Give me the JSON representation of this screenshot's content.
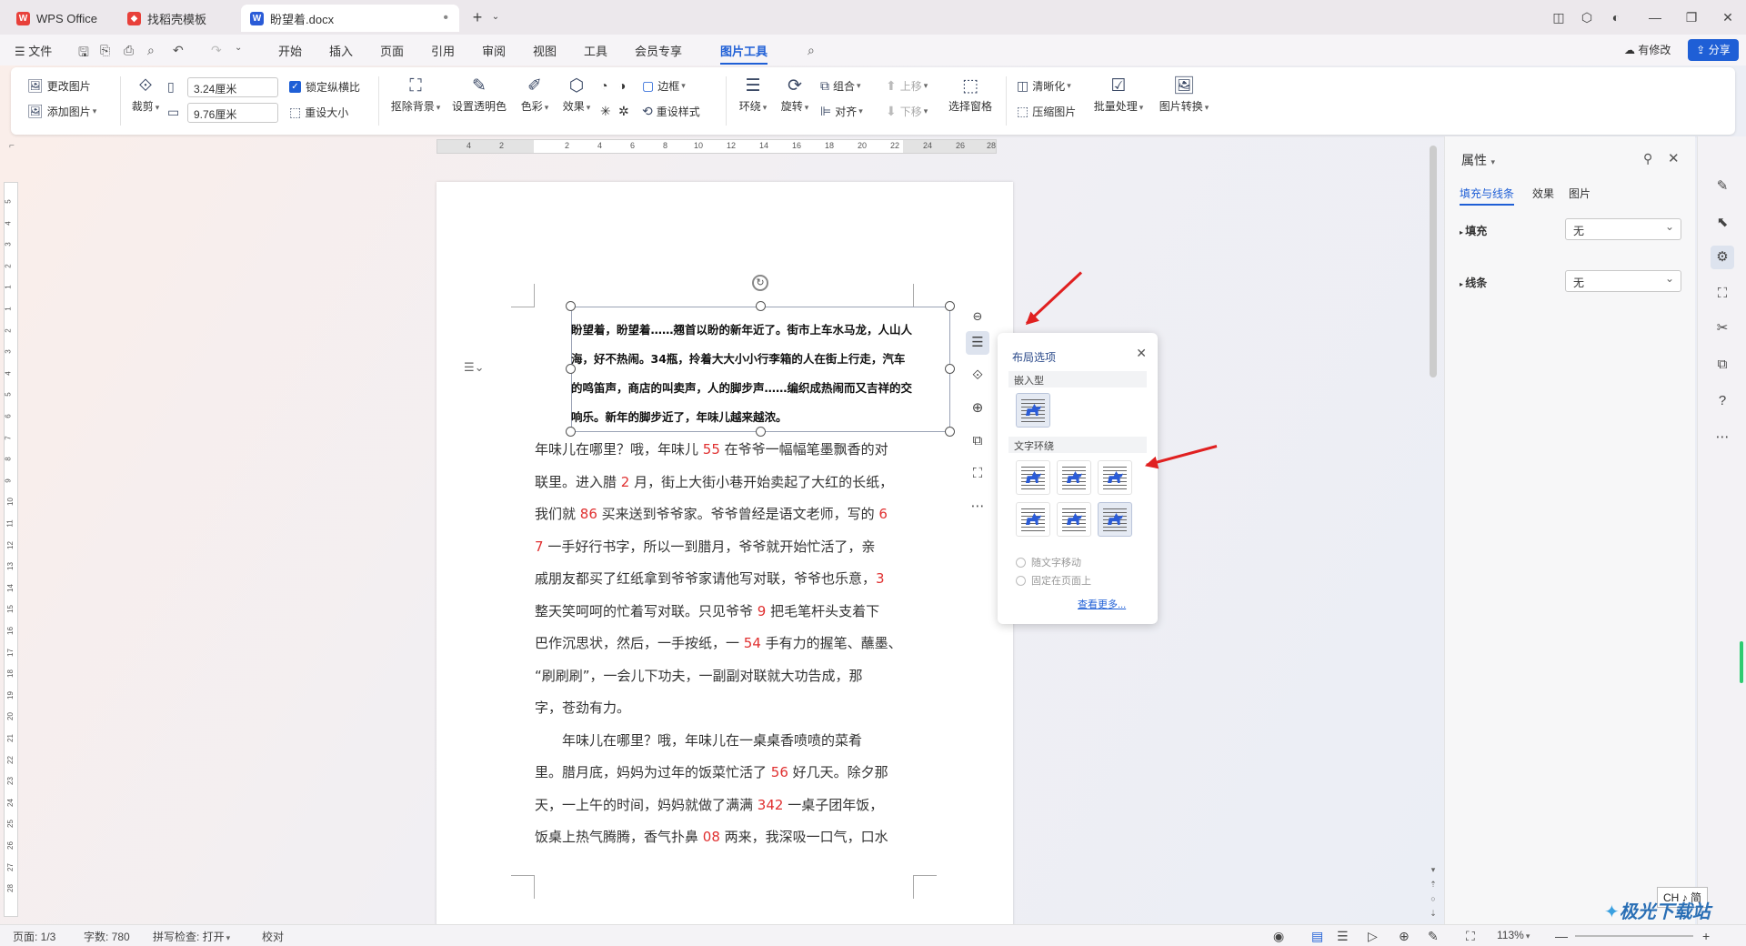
{
  "tabs": [
    {
      "label": "WPS Office"
    },
    {
      "label": "找稻壳模板"
    },
    {
      "label": "盼望着.docx"
    }
  ],
  "menu": {
    "file": "文件",
    "items": [
      "开始",
      "插入",
      "页面",
      "引用",
      "审阅",
      "视图",
      "工具",
      "会员专享",
      "图片工具"
    ],
    "active": "图片工具",
    "modified": "有修改",
    "share": "分享"
  },
  "ribbon": {
    "change_pic": "更改图片",
    "add_pic": "添加图片",
    "crop": "裁剪",
    "width": "3.24厘米",
    "height": "9.76厘米",
    "lock_ratio": "锁定纵横比",
    "reset_size": "重设大小",
    "remove_bg": "抠除背景",
    "set_transparent": "设置透明色",
    "color": "色彩",
    "effect": "效果",
    "border": "边框",
    "reset_style": "重设样式",
    "wrap": "环绕",
    "rotate": "旋转",
    "group": "组合",
    "align": "对齐",
    "up": "上移",
    "down": "下移",
    "select_pane": "选择窗格",
    "sharpen": "清晰化",
    "compress": "压缩图片",
    "batch": "批量处理",
    "convert": "图片转换"
  },
  "ruler_h": [
    "4",
    "2",
    "2",
    "4",
    "6",
    "8",
    "10",
    "12",
    "14",
    "16",
    "18",
    "20",
    "22",
    "24",
    "26",
    "28"
  ],
  "ruler_v": [
    "5",
    "4",
    "3",
    "2",
    "1",
    "1",
    "2",
    "3",
    "4",
    "5",
    "6",
    "7",
    "8",
    "9",
    "10",
    "11",
    "12",
    "13",
    "14",
    "15",
    "16",
    "17",
    "18",
    "19",
    "20",
    "21",
    "22",
    "23",
    "24",
    "25",
    "26",
    "27",
    "28"
  ],
  "image_text": [
    "盼望着，盼望着……翘首以盼的新年近了。街市上车水马龙，人山人",
    "海，好不热闹。34瓶，拎着大大小小行李箱的人在街上行走，汽车",
    "的鸣笛声，商店的叫卖声，人的脚步声……编织成热闹而又吉祥的交",
    "响乐。新年的脚步近了，年味儿越来越浓。"
  ],
  "body_lines": [
    [
      [
        "年味儿在哪里？哦，年味儿 ",
        0
      ],
      [
        "55",
        1
      ],
      [
        " 在爷爷一幅幅笔墨飘香的对",
        0
      ]
    ],
    [
      [
        "联里。进入腊 ",
        0
      ],
      [
        "2",
        1
      ],
      [
        " 月，街上大街小巷开始卖起了大红的长纸，",
        0
      ]
    ],
    [
      [
        "我们就 ",
        0
      ],
      [
        "86",
        1
      ],
      [
        " 买来送到爷爷家。爷爷曾经是语文老师，写的 ",
        0
      ],
      [
        "6",
        1
      ]
    ],
    [
      [
        "7",
        1
      ],
      [
        " 一手好行书字，所以一到腊月，爷爷就开始忙活了，亲",
        0
      ]
    ],
    [
      [
        "戚朋友都买了红纸拿到爷爷家请他写对联，爷爷也乐意，",
        0
      ],
      [
        "3",
        1
      ]
    ],
    [
      [
        "整天笑呵呵的忙着写对联。只见爷爷 ",
        0
      ],
      [
        "9",
        1
      ],
      [
        " 把毛笔杆头支着下",
        0
      ]
    ],
    [
      [
        "巴作沉思状，然后，一手按纸，一 ",
        0
      ],
      [
        "54",
        1
      ],
      [
        " 手有力的握笔、蘸墨、",
        0
      ]
    ],
    [
      [
        "“刷刷刷”，一会儿下功夫，一副副对联就大功告成，那",
        0
      ]
    ],
    [
      [
        "字，苍劲有力。",
        0
      ]
    ],
    [
      [
        "　　年味儿在哪里？哦，年味儿在一桌桌香喷喷的菜肴",
        0
      ]
    ],
    [
      [
        "里。腊月底，妈妈为过年的饭菜忙活了 ",
        0
      ],
      [
        "56",
        1
      ],
      [
        " 好几天。除夕那",
        0
      ]
    ],
    [
      [
        "天，一上午的时间，妈妈就做了满满 ",
        0
      ],
      [
        "342",
        1
      ],
      [
        " 一桌子团年饭，",
        0
      ]
    ],
    [
      [
        "饭桌上热气腾腾，香气扑鼻 ",
        0
      ],
      [
        "08",
        1
      ],
      [
        " 两来，我深吸一口气，口水",
        0
      ]
    ]
  ],
  "layout_popup": {
    "title": "布局选项",
    "inline": "嵌入型",
    "wrap": "文字环绕",
    "move_with_text": "随文字移动",
    "fix_position": "固定在页面上",
    "more": "查看更多..."
  },
  "panel": {
    "title": "属性",
    "tabs": [
      "填充与线条",
      "效果",
      "图片"
    ],
    "fill_label": "填充",
    "fill_value": "无",
    "line_label": "线条",
    "line_value": "无"
  },
  "status": {
    "page": "页面: 1/3",
    "words": "字数: 780",
    "spell": "拼写检查: 打开",
    "proof": "校对",
    "zoom": "113%",
    "ime": "CH ♪ 简"
  },
  "watermark": "极光下载站",
  "colors": {
    "accent": "#1f5fd6",
    "number_red": "#e03030",
    "arrow": "#e02020",
    "wps_red": "#e8403a"
  }
}
